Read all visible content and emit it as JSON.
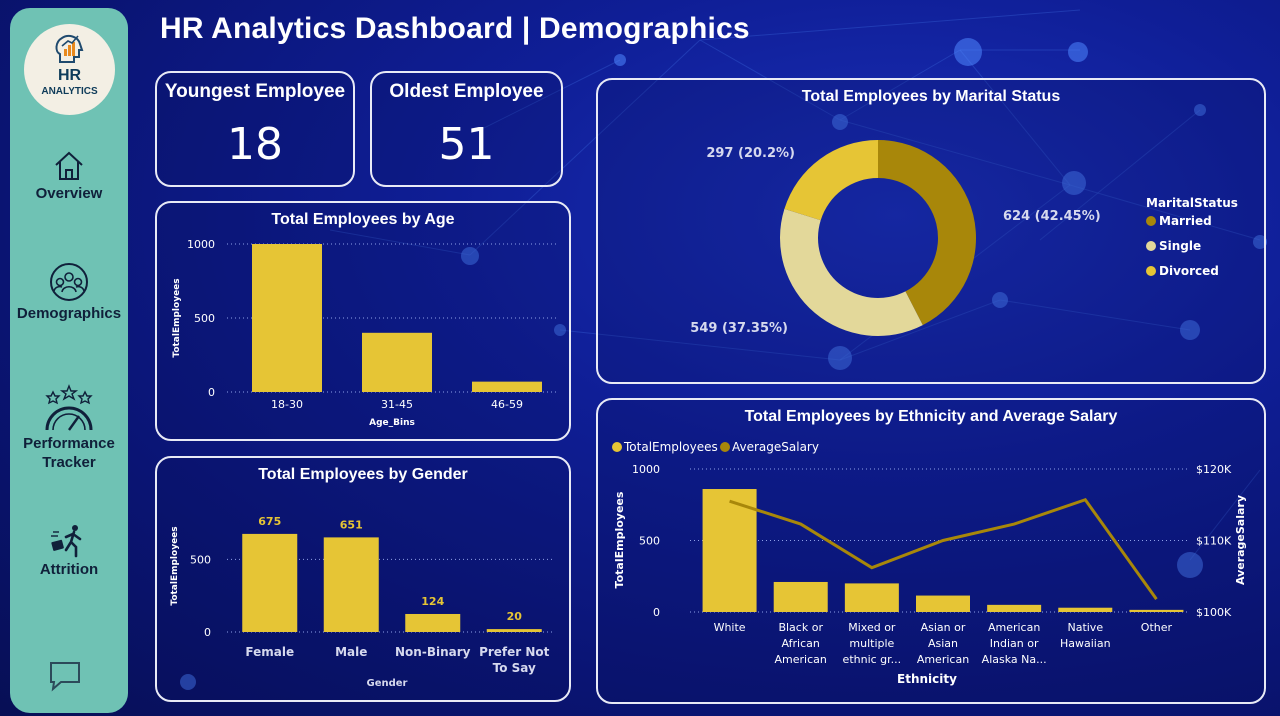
{
  "header": {
    "title": "HR Analytics Dashboard | Demographics"
  },
  "logo": {
    "line1": "HR",
    "line2": "ANALYTICS"
  },
  "sidebar": {
    "items": [
      {
        "label": "Overview",
        "icon": "home-icon"
      },
      {
        "label": "Demographics",
        "icon": "group-icon"
      },
      {
        "label": "Performance Tracker",
        "label_line1": "Performance",
        "label_line2": "Tracker",
        "icon": "gauge-stars-icon"
      },
      {
        "label": "Attrition",
        "icon": "person-leaving-icon"
      }
    ],
    "chat_icon": "chat-icon"
  },
  "kpis": {
    "youngest": {
      "label": "Youngest Employee",
      "value": "18"
    },
    "oldest": {
      "label": "Oldest Employee",
      "value": "51"
    }
  },
  "colors": {
    "gold": "#e6c535",
    "darkgold": "#a8870a",
    "cream": "#e3d89a",
    "border": "#e8eaf6"
  },
  "charts": {
    "age": {
      "title": "Total Employees by Age",
      "type": "bar",
      "categories": [
        "18-30",
        "31-45",
        "46-59"
      ],
      "values": [
        1000,
        400,
        70
      ],
      "xlabel": "Age_Bins",
      "ylabel": "TotalEmployees",
      "ylim": [
        0,
        1000
      ],
      "yticks": [
        "0",
        "500",
        "1000"
      ],
      "grid": true
    },
    "gender": {
      "title": "Total Employees by Gender",
      "type": "bar",
      "categories": [
        "Female",
        "Male",
        "Non-Binary",
        "Prefer Not To Say"
      ],
      "category_lines": [
        [
          "Female"
        ],
        [
          "Male"
        ],
        [
          "Non-Binary"
        ],
        [
          "Prefer Not",
          "To Say"
        ]
      ],
      "values": [
        675,
        651,
        124,
        20
      ],
      "data_labels": [
        "675",
        "651",
        "124",
        "20"
      ],
      "xlabel": "Gender",
      "ylabel": "TotalEmployees",
      "ylim": [
        0,
        750
      ],
      "yticks": [
        "0",
        "500"
      ],
      "grid": true
    },
    "marital": {
      "title": "Total Employees by Marital Status",
      "type": "pie",
      "legend_title": "MaritalStatus",
      "legend_position": "right",
      "slices": [
        {
          "name": "Married",
          "value": 624,
          "label": "624 (42.45%)",
          "color": "#a8870a"
        },
        {
          "name": "Single",
          "value": 549,
          "label": "549 (37.35%)",
          "color": "#e3d89a"
        },
        {
          "name": "Divorced",
          "value": 297,
          "label": "297 (20.2%)",
          "color": "#e6c535"
        }
      ]
    },
    "ethnicity": {
      "title": "Total Employees by Ethnicity and Average Salary",
      "type": "bar",
      "legend": [
        {
          "name": "TotalEmployees",
          "color": "#e6c535"
        },
        {
          "name": "AverageSalary",
          "color": "#a8870a"
        }
      ],
      "categories": [
        "White",
        "Black or African American",
        "Mixed or multiple ethnic gr...",
        "Asian or Asian American",
        "American Indian or Alaska Na...",
        "Native Hawaiian",
        "Other"
      ],
      "category_lines": [
        [
          "White"
        ],
        [
          "Black or",
          "African",
          "American"
        ],
        [
          "Mixed or",
          "multiple",
          "ethnic gr..."
        ],
        [
          "Asian or",
          "Asian",
          "American"
        ],
        [
          "American",
          "Indian or",
          "Alaska Na..."
        ],
        [
          "Native",
          "Hawaiian"
        ],
        [
          "Other"
        ]
      ],
      "series": [
        {
          "name": "TotalEmployees",
          "type": "bar",
          "values": [
            860,
            210,
            200,
            115,
            50,
            30,
            15
          ]
        },
        {
          "name": "AverageSalary",
          "type": "line",
          "values": [
            115500,
            112300,
            106200,
            110000,
            112300,
            115700,
            101800
          ]
        }
      ],
      "xlabel": "Ethnicity",
      "ylabel": "TotalEmployees",
      "y2label": "AverageSalary",
      "ylim": [
        0,
        1000
      ],
      "y2lim": [
        100000,
        120000
      ],
      "yticks": [
        "0",
        "500",
        "1000"
      ],
      "y2ticks": [
        "$100K",
        "$110K",
        "$120K"
      ],
      "grid": true
    }
  }
}
